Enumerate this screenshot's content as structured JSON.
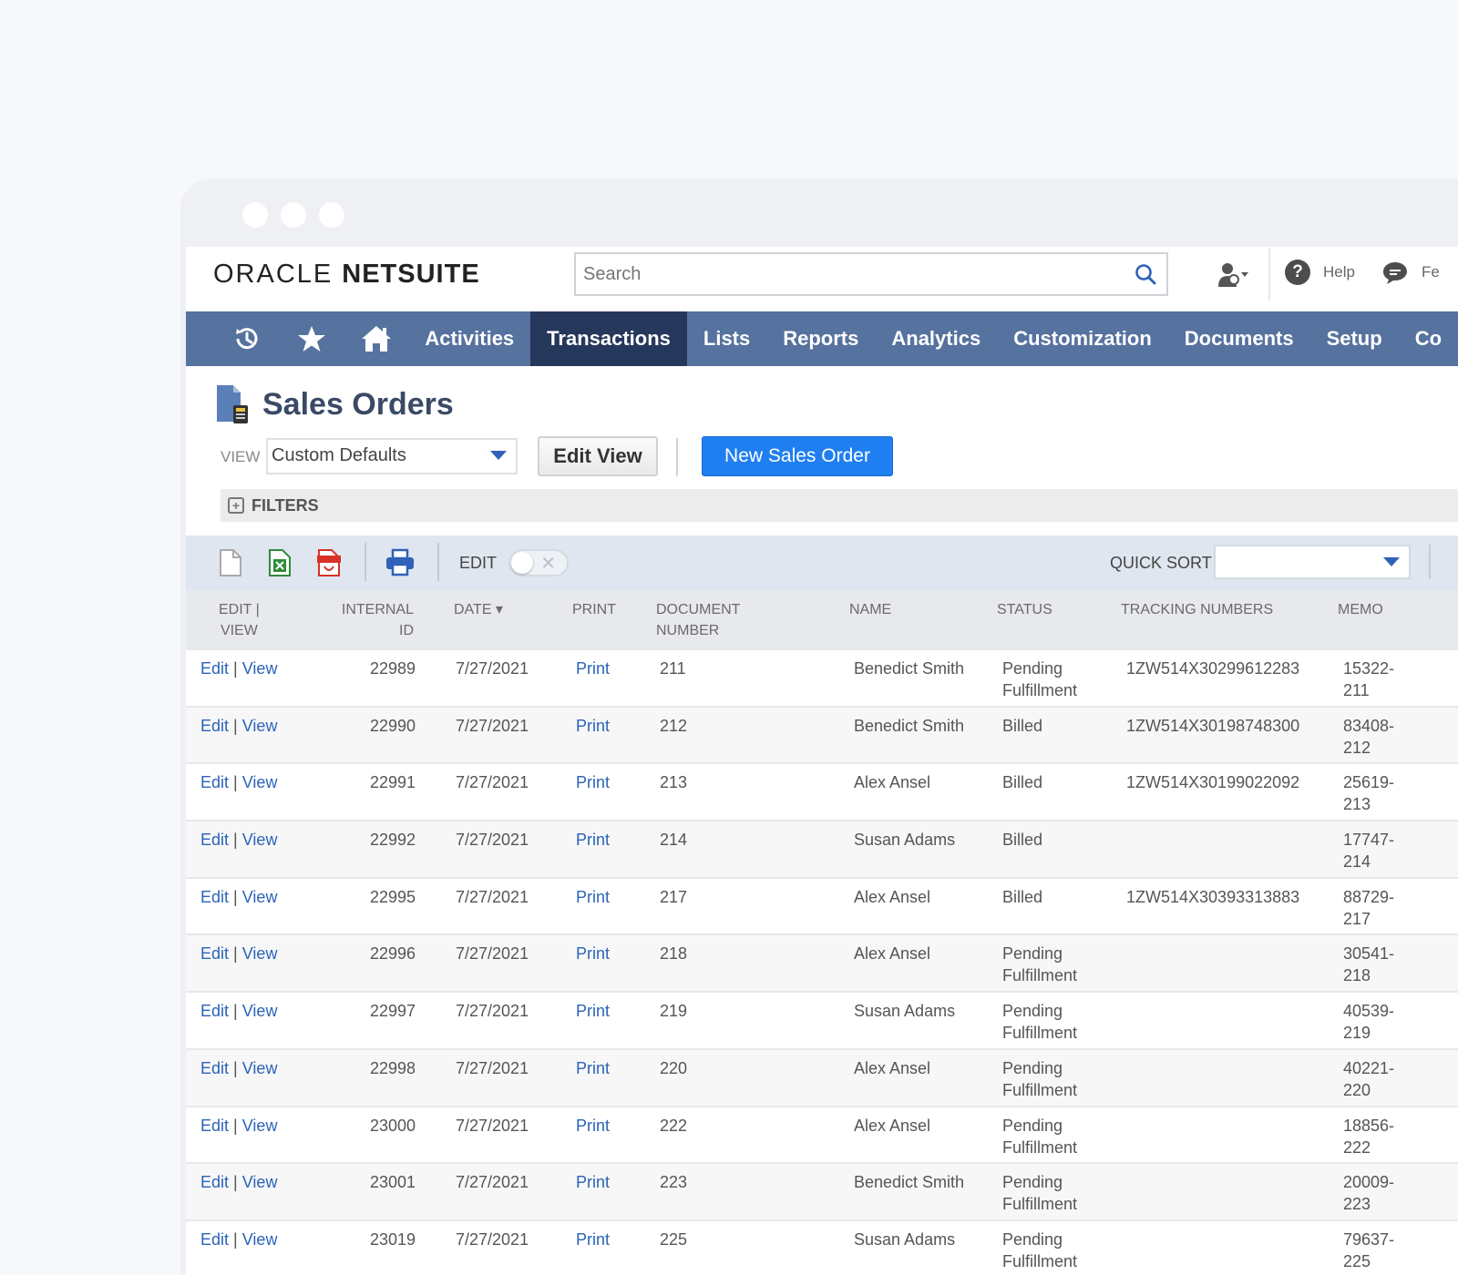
{
  "brand": {
    "oracle": "ORACLE",
    "netsuite": "NETSUITE"
  },
  "header": {
    "search_placeholder": "Search",
    "help_label": "Help",
    "feedback_label": "Fe"
  },
  "nav": {
    "items": [
      "Activities",
      "Transactions",
      "Lists",
      "Reports",
      "Analytics",
      "Customization",
      "Documents",
      "Setup",
      "Co"
    ],
    "active": "Transactions"
  },
  "page": {
    "title": "Sales Orders",
    "view_label": "VIEW",
    "view_value": "Custom Defaults",
    "edit_view_label": "Edit View",
    "new_button_label": "New Sales Order",
    "filters_label": "FILTERS"
  },
  "toolbar": {
    "edit_label": "EDIT",
    "edit_toggle_on": false,
    "quick_sort_label": "QUICK SORT",
    "quick_sort_value": ""
  },
  "table": {
    "columns": {
      "edit_view": [
        "EDIT |",
        "VIEW"
      ],
      "internal_id": [
        "INTERNAL",
        "ID"
      ],
      "date": "DATE ▾",
      "print": "PRINT",
      "document_number": [
        "DOCUMENT",
        "NUMBER"
      ],
      "name": "NAME",
      "status": "STATUS",
      "tracking": "TRACKING NUMBERS",
      "memo": "MEMO"
    },
    "edit_text": "Edit",
    "view_text": "View",
    "separator": "|",
    "rows": [
      {
        "id": "22989",
        "date": "7/27/2021",
        "print": "Print",
        "doc": "211",
        "name": "Benedict Smith",
        "status": "Pending Fulfillment",
        "tracking": "1ZW514X30299612283",
        "memo": "15322-211"
      },
      {
        "id": "22990",
        "date": "7/27/2021",
        "print": "Print",
        "doc": "212",
        "name": "Benedict Smith",
        "status": "Billed",
        "tracking": "1ZW514X30198748300",
        "memo": "83408-212"
      },
      {
        "id": "22991",
        "date": "7/27/2021",
        "print": "Print",
        "doc": "213",
        "name": "Alex Ansel",
        "status": "Billed",
        "tracking": "1ZW514X30199022092",
        "memo": "25619-213"
      },
      {
        "id": "22992",
        "date": "7/27/2021",
        "print": "Print",
        "doc": "214",
        "name": "Susan Adams",
        "status": "Billed",
        "tracking": "",
        "memo": "17747-214"
      },
      {
        "id": "22995",
        "date": "7/27/2021",
        "print": "Print",
        "doc": "217",
        "name": "Alex Ansel",
        "status": "Billed",
        "tracking": "1ZW514X30393313883",
        "memo": "88729-217"
      },
      {
        "id": "22996",
        "date": "7/27/2021",
        "print": "Print",
        "doc": "218",
        "name": "Alex Ansel",
        "status": "Pending Fulfillment",
        "tracking": "",
        "memo": "30541-218"
      },
      {
        "id": "22997",
        "date": "7/27/2021",
        "print": "Print",
        "doc": "219",
        "name": "Susan Adams",
        "status": "Pending Fulfillment",
        "tracking": "",
        "memo": "40539-219"
      },
      {
        "id": "22998",
        "date": "7/27/2021",
        "print": "Print",
        "doc": "220",
        "name": "Alex Ansel",
        "status": "Pending Fulfillment",
        "tracking": "",
        "memo": "40221-220"
      },
      {
        "id": "23000",
        "date": "7/27/2021",
        "print": "Print",
        "doc": "222",
        "name": "Alex Ansel",
        "status": "Pending Fulfillment",
        "tracking": "",
        "memo": "18856-222"
      },
      {
        "id": "23001",
        "date": "7/27/2021",
        "print": "Print",
        "doc": "223",
        "name": "Benedict Smith",
        "status": "Pending Fulfillment",
        "tracking": "",
        "memo": "20009-223"
      },
      {
        "id": "23019",
        "date": "7/27/2021",
        "print": "Print",
        "doc": "225",
        "name": "Susan Adams",
        "status": "Pending Fulfillment",
        "tracking": "",
        "memo": "79637-225"
      }
    ]
  },
  "colors": {
    "nav_bg": "#56729f",
    "nav_active": "#26375c",
    "primary_button": "#1f7ff0",
    "link": "#2b63b8",
    "toolbar_bg": "#dfe6ef"
  }
}
